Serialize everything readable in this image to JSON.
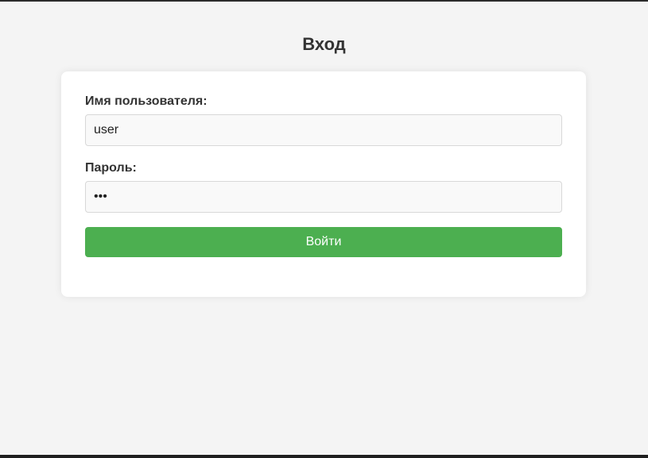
{
  "page": {
    "title": "Вход"
  },
  "form": {
    "username": {
      "label": "Имя пользователя:",
      "value": "user"
    },
    "password": {
      "label": "Пароль:",
      "value": "•••"
    },
    "submit_label": "Войти"
  },
  "colors": {
    "background": "#f4f4f4",
    "card": "#ffffff",
    "button": "#4caf50",
    "button_text": "#ffffff",
    "text": "#333333"
  }
}
